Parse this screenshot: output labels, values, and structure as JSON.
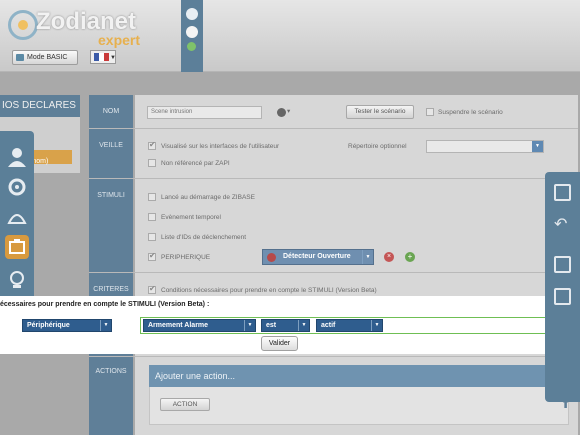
{
  "header": {
    "logo_text": "Zodianet",
    "logo_sub": "expert",
    "mode_button": "Mode BASIC"
  },
  "left": {
    "declared_title": "IOS DECLARES ...",
    "selected_item": "(nom)"
  },
  "sections": {
    "nom": "NOM",
    "veille": "VEILLE",
    "stimuli": "STIMULI",
    "criteres": "CRITERES",
    "actions": "ACTIONS"
  },
  "nom": {
    "scenario_name": "Scene intrusion",
    "test_button": "Tester le scénario",
    "suspend_label": "Suspendre le scénario"
  },
  "veille": {
    "visualise_label": "Visualisé sur les interfaces de l'utilisateur",
    "reference_label": "Non référencé par ZAPI",
    "repertoire_label": "Répertoire optionnel"
  },
  "stimuli": {
    "demarrage": "Lancé au démarrage de ZIBASE",
    "evenement": "Evènement temporel",
    "liste_ids": "Liste d'IDs de déclenchement",
    "peripherique": "PERIPHERIQUE",
    "device_select": "Détecteur Ouverture"
  },
  "criteres": {
    "conditions_label": "Conditions nécessaires pour prendre en compte le STIMULI (Version Beta)"
  },
  "overlay": {
    "title": "écessaires pour prendre en compte le STIMULI (Version Beta) :",
    "type_select": "Périphérique",
    "device_select": "Armement Alarme",
    "operator_select": "est",
    "value_select": "actif",
    "validate_button": "Valider"
  },
  "actions": {
    "add_header": "Ajouter une action...",
    "action_button": "ACTION"
  },
  "colors": {
    "accent": "#5c7f98",
    "select_bg": "#2f5d8e",
    "valid_frame": "#6fbf54"
  }
}
